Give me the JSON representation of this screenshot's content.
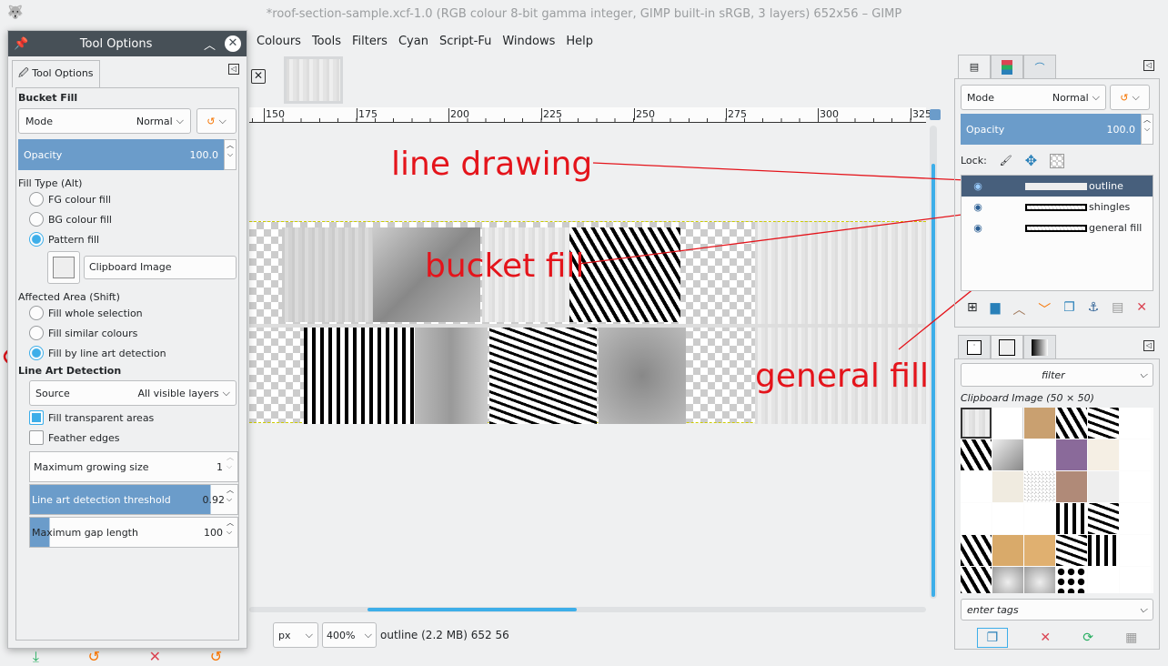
{
  "window": {
    "title": "*roof-section-sample.xcf-1.0 (RGB colour 8-bit gamma integer, GIMP built-in sRGB, 3 layers) 652x56 – GIMP"
  },
  "menu": [
    "Colours",
    "Tools",
    "Filters",
    "Cyan",
    "Script-Fu",
    "Windows",
    "Help"
  ],
  "ruler": [
    "150",
    "175",
    "200",
    "225",
    "250",
    "275",
    "300",
    "325"
  ],
  "tool_options": {
    "title": "Tool Options",
    "tab": "Tool Options",
    "tool": "Bucket Fill",
    "mode_label": "Mode",
    "mode_value": "Normal",
    "opacity_label": "Opacity",
    "opacity_value": "100.0",
    "opacity_pct": 100,
    "fill_type_label": "Fill Type  (Alt)",
    "fill_types": [
      "FG colour fill",
      "BG colour fill",
      "Pattern fill"
    ],
    "pattern_name": "Clipboard Image",
    "affected_label": "Affected Area  (Shift)",
    "affected": [
      "Fill whole selection",
      "Fill similar colours",
      "Fill by line art detection"
    ],
    "lineart_label": "Line Art Detection",
    "source_label": "Source",
    "source_value": "All visible layers",
    "fill_transparent": "Fill transparent areas",
    "feather": "Feather edges",
    "max_grow_label": "Maximum growing size",
    "max_grow_value": "1",
    "threshold_label": "Line art detection threshold",
    "threshold_value": "0.92",
    "threshold_fraction": 0.92,
    "gap_label": "Maximum gap length",
    "gap_value": "100"
  },
  "annotations": {
    "line_drawing": "line drawing",
    "bucket_fill": "bucket fill",
    "general_fill": "general fill"
  },
  "layers_panel": {
    "mode_label": "Mode",
    "mode_value": "Normal",
    "opacity_label": "Opacity",
    "opacity_value": "100.0",
    "lock_label": "Lock:",
    "layers": [
      {
        "name": "outline",
        "selected": true
      },
      {
        "name": "shingles",
        "selected": false
      },
      {
        "name": "general fill",
        "selected": false
      }
    ]
  },
  "patterns_panel": {
    "filter_placeholder": "filter",
    "pattern_title": "Clipboard Image (50 × 50)",
    "tags_placeholder": "enter tags"
  },
  "status": {
    "unit": "px",
    "zoom": "400%",
    "info": "outline (2.2 MB) 652 56"
  }
}
